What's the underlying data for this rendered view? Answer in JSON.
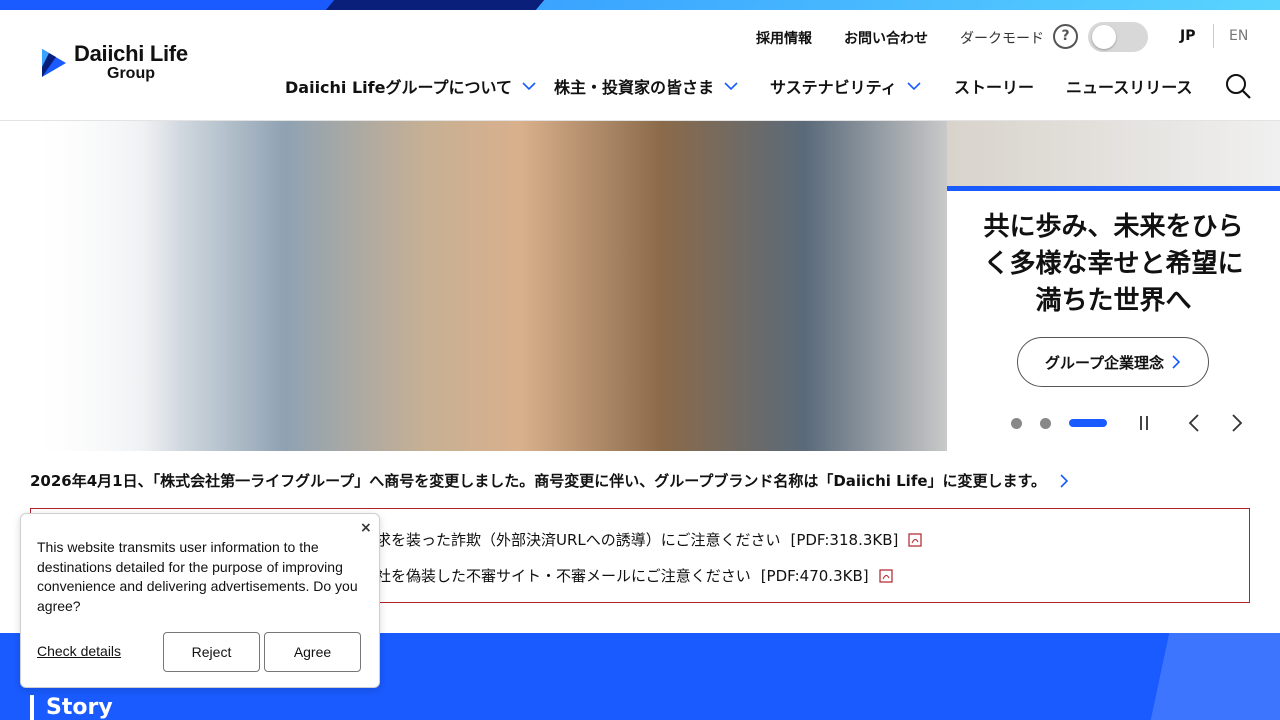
{
  "brand": {
    "name_line1": "Daiichi Life",
    "name_line2": "Group",
    "colors": {
      "primary": "#1a5bff",
      "dark": "#0a1f7a",
      "alert": "#b0212b"
    }
  },
  "utility": {
    "recruit": "採用情報",
    "contact": "お問い合わせ",
    "dark_mode": "ダークモード",
    "help": "?",
    "lang_jp": "JP",
    "lang_en": "EN"
  },
  "nav": {
    "items": [
      {
        "label": "Daiichi Lifeグループについて",
        "has_dropdown": true
      },
      {
        "label": "株主・投資家の皆さま",
        "has_dropdown": true
      },
      {
        "label": "サステナビリティ",
        "has_dropdown": true
      },
      {
        "label": "ストーリー",
        "has_dropdown": false
      },
      {
        "label": "ニュースリリース",
        "has_dropdown": false
      }
    ],
    "search_icon": "search-icon"
  },
  "hero": {
    "title": "共に歩み、未来をひらく多様な幸せと希望に満ちた世界へ",
    "button": "グループ企業理念",
    "slides_total": 3,
    "active_slide": 3
  },
  "notice": {
    "text": "2026年4月1日、「株式会社第一ライフグループ」へ商号を変更しました。商号変更に伴い、グループブランド名称は「Daiichi Life」に変更します。"
  },
  "alerts": [
    {
      "text": "要】請求を装った詐欺（外部決済URLへの誘導）にご注意ください",
      "size": "[PDF:318.3KB]"
    },
    {
      "text": "要】当社を偽装した不審サイト・不審メールにご注意ください",
      "size": "[PDF:470.3KB]"
    }
  ],
  "story": {
    "title": "Story"
  },
  "cookie": {
    "close": "×",
    "message": "This website transmits user information to the destinations detailed for the purpose of improving convenience and delivering advertisements. Do you agree?",
    "details": "Check details",
    "reject": "Reject",
    "agree": "Agree"
  }
}
